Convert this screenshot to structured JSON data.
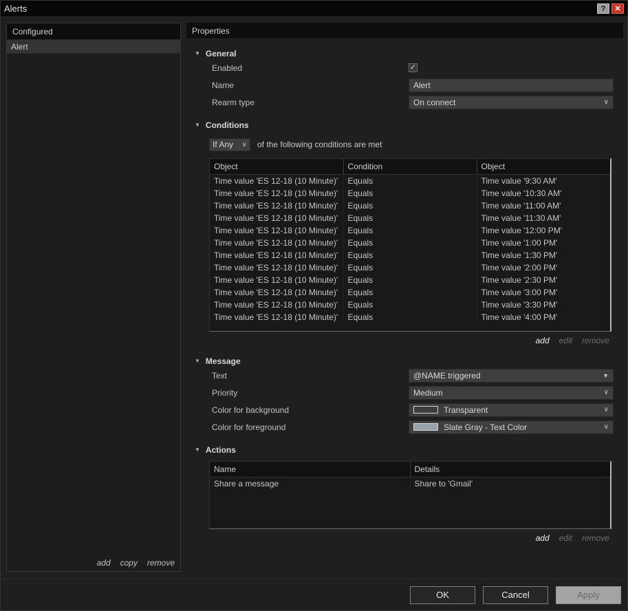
{
  "window": {
    "title": "Alerts",
    "help_button": "?",
    "close_button": "✕"
  },
  "left_panel": {
    "header": "Configured",
    "items": [
      {
        "label": "Alert",
        "selected": true
      }
    ],
    "links": {
      "add": "add",
      "copy": "copy",
      "remove": "remove"
    }
  },
  "properties": {
    "header": "Properties",
    "general": {
      "title": "General",
      "enabled_label": "Enabled",
      "enabled_checked": true,
      "name_label": "Name",
      "name_value": "Alert",
      "rearm_label": "Rearm type",
      "rearm_value": "On connect"
    },
    "conditions": {
      "title": "Conditions",
      "match_value": "If Any",
      "match_suffix": "of the following conditions are met",
      "table": {
        "columns": [
          "Object",
          "Condition",
          "Object"
        ],
        "rows": [
          [
            "Time value 'ES 12-18 (10 Minute)'",
            "Equals",
            "Time value '9:30 AM'"
          ],
          [
            "Time value 'ES 12-18 (10 Minute)'",
            "Equals",
            "Time value '10:30 AM'"
          ],
          [
            "Time value 'ES 12-18 (10 Minute)'",
            "Equals",
            "Time value '11:00 AM'"
          ],
          [
            "Time value 'ES 12-18 (10 Minute)'",
            "Equals",
            "Time value '11:30 AM'"
          ],
          [
            "Time value 'ES 12-18 (10 Minute)'",
            "Equals",
            "Time value '12:00 PM'"
          ],
          [
            "Time value 'ES 12-18 (10 Minute)'",
            "Equals",
            "Time value '1:00 PM'"
          ],
          [
            "Time value 'ES 12-18 (10 Minute)'",
            "Equals",
            "Time value '1:30 PM'"
          ],
          [
            "Time value 'ES 12-18 (10 Minute)'",
            "Equals",
            "Time value '2:00 PM'"
          ],
          [
            "Time value 'ES 12-18 (10 Minute)'",
            "Equals",
            "Time value '2:30 PM'"
          ],
          [
            "Time value 'ES 12-18 (10 Minute)'",
            "Equals",
            "Time value '3:00 PM'"
          ],
          [
            "Time value 'ES 12-18 (10 Minute)'",
            "Equals",
            "Time value '3:30 PM'"
          ],
          [
            "Time value 'ES 12-18 (10 Minute)'",
            "Equals",
            "Time value '4:00 PM'"
          ]
        ]
      },
      "links": {
        "add": "add",
        "edit": "edit",
        "remove": "remove"
      }
    },
    "message": {
      "title": "Message",
      "text_label": "Text",
      "text_value": "@NAME triggered",
      "priority_label": "Priority",
      "priority_value": "Medium",
      "background_label": "Color for background",
      "background_value": "Transparent",
      "background_swatch": "transparent",
      "foreground_label": "Color for foreground",
      "foreground_value": "Slate Gray - Text Color",
      "foreground_swatch": "#9aa2aa"
    },
    "actions": {
      "title": "Actions",
      "table": {
        "columns": [
          "Name",
          "Details"
        ],
        "rows": [
          [
            "Share a message",
            "Share to 'Gmail'"
          ]
        ]
      },
      "links": {
        "add": "add",
        "edit": "edit",
        "remove": "remove"
      }
    }
  },
  "footer": {
    "ok": "OK",
    "cancel": "Cancel",
    "apply": "Apply"
  }
}
